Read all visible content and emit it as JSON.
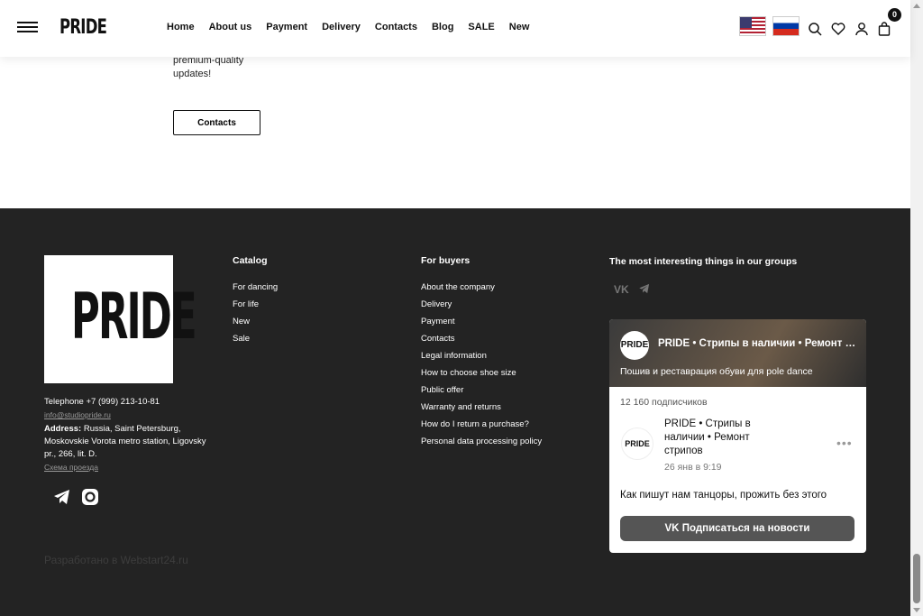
{
  "header": {
    "logo": "PRIDE",
    "nav": [
      "Home",
      "About us",
      "Payment",
      "Delivery",
      "Contacts",
      "Blog",
      "SALE",
      "New"
    ],
    "cart_count": "0",
    "icons": [
      "menu-icon",
      "us-flag-icon",
      "ru-flag-icon",
      "search-icon",
      "heart-icon",
      "user-icon",
      "cart-icon"
    ]
  },
  "upper": {
    "text": "premium-quality updates!",
    "contacts_button": "Contacts"
  },
  "footer": {
    "logo": "PRIDE",
    "telephone": "Telephone +7 (999) 213-10-81",
    "email": "info@studiopride.ru",
    "address_label": "Address:",
    "address_text": " Russia, Saint Petersburg, Moskovskie Vorota metro station, Ligovsky pr., 266, lit. D.",
    "map_link": "Схема проезда",
    "catalog": {
      "title": "Catalog",
      "items": [
        "For dancing",
        "For life",
        "New",
        "Sale"
      ]
    },
    "buyers": {
      "title": "For buyers",
      "items": [
        "About the company",
        "Delivery",
        "Payment",
        "Contacts",
        "Legal information",
        "How to choose shoe size",
        "Public offer",
        "Warranty and returns",
        "How do I return a purchase?",
        "Personal data processing policy"
      ]
    },
    "groups_title": "The most interesting things in our groups",
    "developer": "Разработано в Webstart24.ru",
    "widget": {
      "cover_title": "PRIDE • Стрипы в наличии • Ремонт стрипов",
      "cover_subtitle": "Пошив и реставрация обуви для pole dance",
      "subscribers": "12 160 подписчиков",
      "post_title": "PRIDE • Стрипы в наличии • Ремонт стрипов",
      "post_date": "26 янв в 9:19",
      "post_text": "Как пишут нам танцоры, прожить без этого",
      "subscribe_button": "Подписаться на новости",
      "avatar_text": "PRIDE"
    }
  },
  "colors": {
    "footer_bg": "#232323",
    "widget_button": "#555555"
  }
}
